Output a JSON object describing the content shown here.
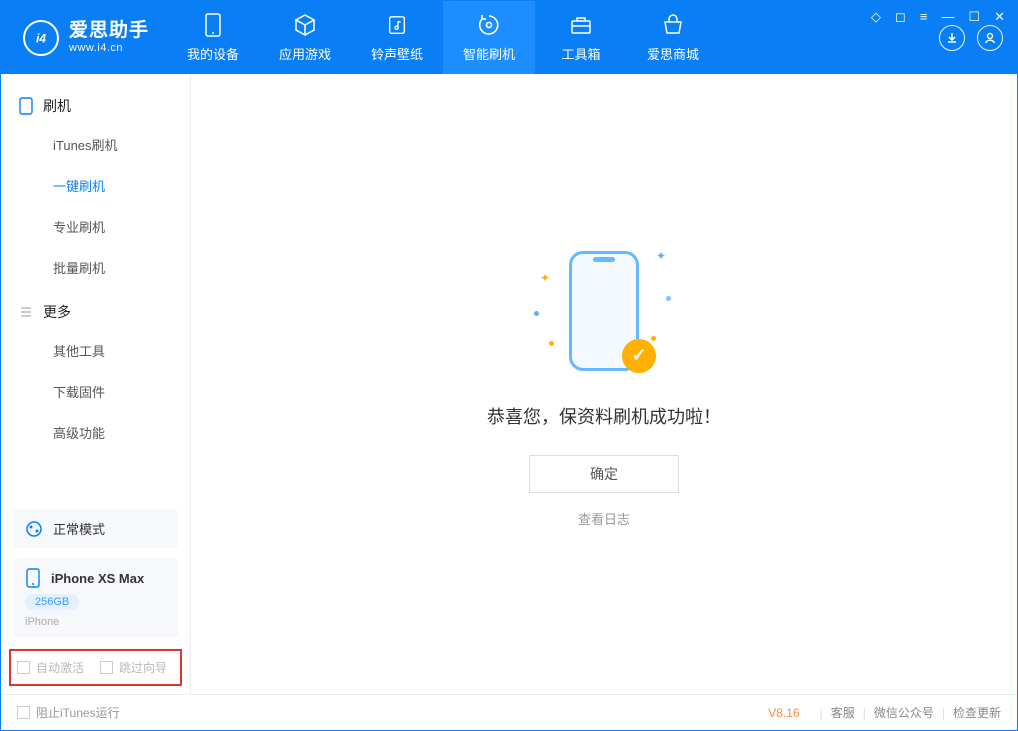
{
  "app": {
    "title": "爱思助手",
    "subtitle": "www.i4.cn"
  },
  "tabs": {
    "device": "我的设备",
    "apps": "应用游戏",
    "ringtone": "铃声壁纸",
    "flash": "智能刷机",
    "toolbox": "工具箱",
    "store": "爱思商城"
  },
  "sidebar": {
    "section_flash": "刷机",
    "items_flash": {
      "itunes": "iTunes刷机",
      "oneclick": "一键刷机",
      "pro": "专业刷机",
      "batch": "批量刷机"
    },
    "section_more": "更多",
    "items_more": {
      "other": "其他工具",
      "firmware": "下载固件",
      "advanced": "高级功能"
    },
    "status_mode": "正常模式",
    "device": {
      "name": "iPhone XS Max",
      "capacity": "256GB",
      "type": "iPhone"
    },
    "checkbox_activate": "自动激活",
    "checkbox_skip": "跳过向导"
  },
  "main": {
    "success_text": "恭喜您，保资料刷机成功啦！",
    "ok_button": "确定",
    "log_link": "查看日志"
  },
  "footer": {
    "block_itunes": "阻止iTunes运行",
    "version": "V8.16",
    "support": "客服",
    "wechat": "微信公众号",
    "update": "检查更新"
  }
}
